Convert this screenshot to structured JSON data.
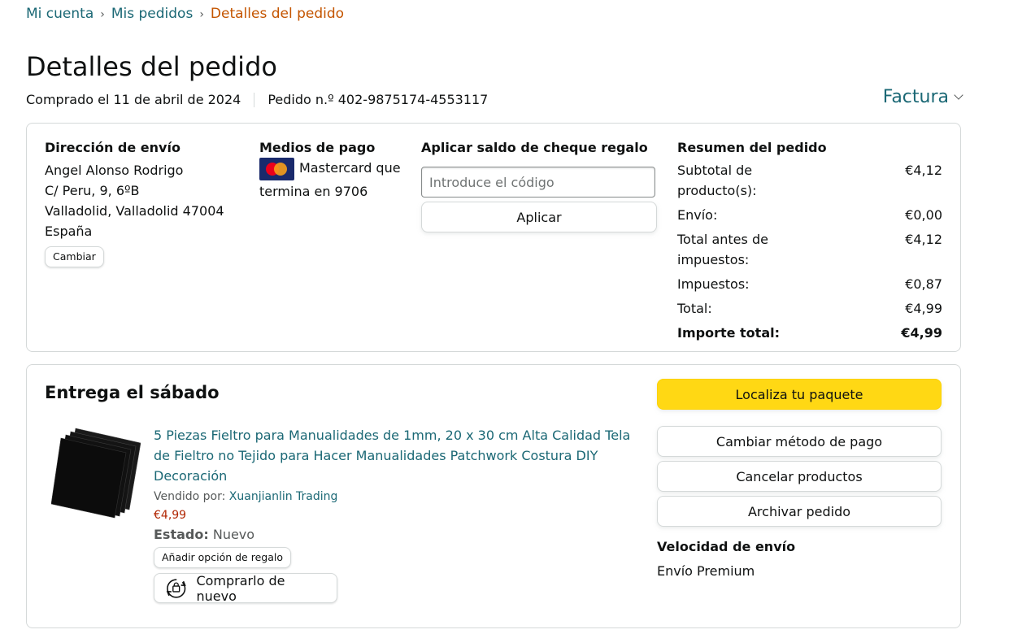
{
  "breadcrumb": {
    "items": [
      "Mi cuenta",
      "Mis pedidos"
    ],
    "current": "Detalles del pedido",
    "separator": "›"
  },
  "title": "Detalles del pedido",
  "meta": {
    "purchased": "Comprado el 11 de abril de 2024",
    "order_number": "Pedido n.º 402-9875174-4553117"
  },
  "invoice_label": "Factura",
  "shipping": {
    "heading": "Dirección de envío",
    "lines": [
      "Angel Alonso Rodrigo",
      "C/ Peru, 9, 6ºB",
      "Valladolid, Valladolid 47004",
      "España"
    ],
    "change_label": "Cambiar"
  },
  "payment": {
    "heading": "Medios de pago",
    "method_line1": "Mastercard que",
    "method_line2": "termina en 9706",
    "card_icon": "mastercard-icon"
  },
  "gift_card": {
    "heading": "Aplicar saldo de cheque regalo",
    "placeholder": "Introduce el código",
    "apply_label": "Aplicar"
  },
  "summary": {
    "heading": "Resumen del pedido",
    "rows": [
      {
        "label": "Subtotal de producto(s):",
        "value": "€4,12"
      },
      {
        "label": "Envío:",
        "value": "€0,00"
      },
      {
        "label": "Total antes de impuestos:",
        "value": "€4,12"
      },
      {
        "label": "Impuestos:",
        "value": "€0,87"
      },
      {
        "label": "Total:",
        "value": "€4,99"
      }
    ],
    "grand_total": {
      "label": "Importe total:",
      "value": "€4,99"
    }
  },
  "delivery": {
    "heading": "Entrega el sábado",
    "item": {
      "title": "5 Piezas Fieltro para Manualidades de 1mm, 20 x 30 cm Alta Calidad Tela de Fieltro no Tejido para Hacer Manualidades Patchwork Costura DIY Decoración",
      "sold_by_label": "Vendido por:",
      "seller": "Xuanjianlin Trading",
      "price": "€4,99",
      "state_label": "Estado:",
      "state_value": "Nuevo",
      "gift_option_label": "Añadir opción de regalo",
      "buy_again_label": "Comprarlo de nuevo",
      "buy_again_icon": "buy-again-icon"
    },
    "actions": {
      "track": "Localiza tu paquete",
      "change_payment": "Cambiar método de pago",
      "cancel": "Cancelar productos",
      "archive": "Archivar pedido"
    },
    "speed_heading": "Velocidad de envío",
    "speed_value": "Envío Premium"
  },
  "colors": {
    "link": "#1b6875",
    "current_breadcrumb": "#c45500",
    "price": "#b12704",
    "primary_button": "#ffd814",
    "border": "#d5d9d9"
  }
}
